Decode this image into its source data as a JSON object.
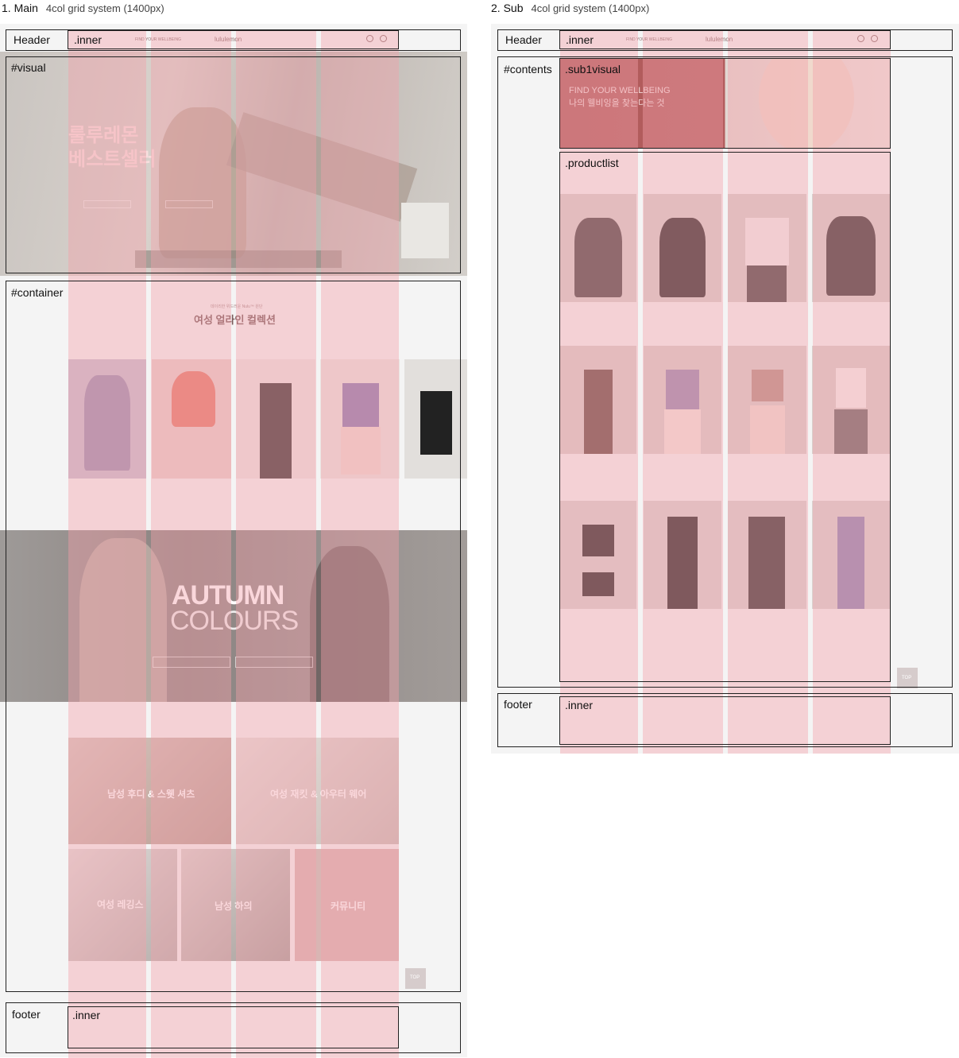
{
  "main": {
    "heading": "1. Main",
    "grid": "4col grid system (1400px)",
    "sections": {
      "header": "Header",
      "header_inner": ".inner",
      "visual": "#visual",
      "container": "#container",
      "footer": "footer",
      "footer_inner": ".inner"
    },
    "header_nav": [
      "FIND YOUR WELLBEING"
    ],
    "logo": "lululemon",
    "visual_text": {
      "line1": "룰루레몬",
      "line2": "베스트셀러"
    },
    "collection": {
      "eyebrow": "데이리한 위드러운 Nulu™ 원단",
      "title": "여성 얼라인 컬렉션"
    },
    "autumn": {
      "line1": "AUTUMN",
      "line2": "COLOURS"
    },
    "tiles": [
      "남성 후디 & 스웻 셔츠",
      "여성 재킷 & 아우터 웨어",
      "여성 레깅스",
      "남성 하의",
      "커뮤니티"
    ],
    "top_button": "TOP"
  },
  "sub": {
    "heading": "2. Sub",
    "grid": "4col grid system (1400px)",
    "sections": {
      "header": "Header",
      "header_inner": ".inner",
      "contents": "#contents",
      "sub1visual": ".sub1visual",
      "productlist": ".productlist",
      "footer": "footer",
      "footer_inner": ".inner"
    },
    "header_nav": [
      "FIND YOUR WELLBEING"
    ],
    "logo": "lululemon",
    "visual_text": {
      "line1": "FIND YOUR WELLBEING",
      "line2": "나의 웰비잉을 찾는다는 것"
    },
    "top_button": "TOP"
  },
  "colors": {
    "overlay": "#f2a0aa",
    "frame": "#222222",
    "panel": "#f2f2f2"
  }
}
